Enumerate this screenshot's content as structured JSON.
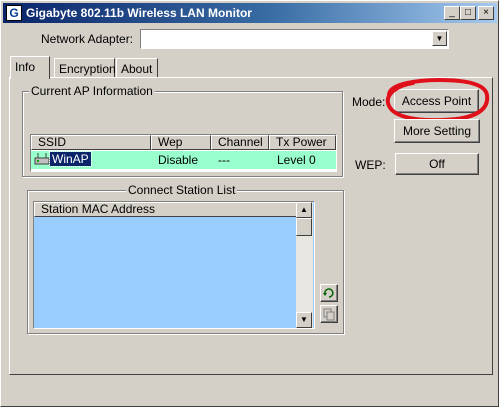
{
  "window": {
    "title": "Gigabyte 802.11b Wireless LAN Monitor",
    "app_icon_glyph": "G",
    "controls": {
      "minimize": "_",
      "maximize": "□",
      "close": "×"
    }
  },
  "adapter": {
    "label": "Network Adapter:",
    "value": ""
  },
  "tabs": [
    {
      "label": "Info",
      "active": true
    },
    {
      "label": "Encryption",
      "active": false
    },
    {
      "label": "About",
      "active": false
    }
  ],
  "current_ap": {
    "title": "Current AP Information",
    "columns": [
      "SSID",
      "Wep",
      "Channel",
      "Tx Power"
    ],
    "row": {
      "ssid": "WinAP",
      "wep": "Disable",
      "channel": "---",
      "tx_power": "Level 0"
    }
  },
  "mode": {
    "label": "Mode:",
    "value": "Access Point"
  },
  "more_setting": {
    "label": "More Setting"
  },
  "wep": {
    "label": "WEP:",
    "value": "Off"
  },
  "station_list": {
    "title": "Connect Station List",
    "column": "Station MAC Address"
  },
  "icons": {
    "refresh": "refresh-icon",
    "copy": "copy-icon",
    "ap": "access-point-icon"
  },
  "colors": {
    "title_start": "#0a246a",
    "title_end": "#a6caf0",
    "selected_row": "#99ffcc",
    "list_bg": "#99ccff",
    "highlight_circle": "#e0101a",
    "selection": "#0a246a"
  }
}
